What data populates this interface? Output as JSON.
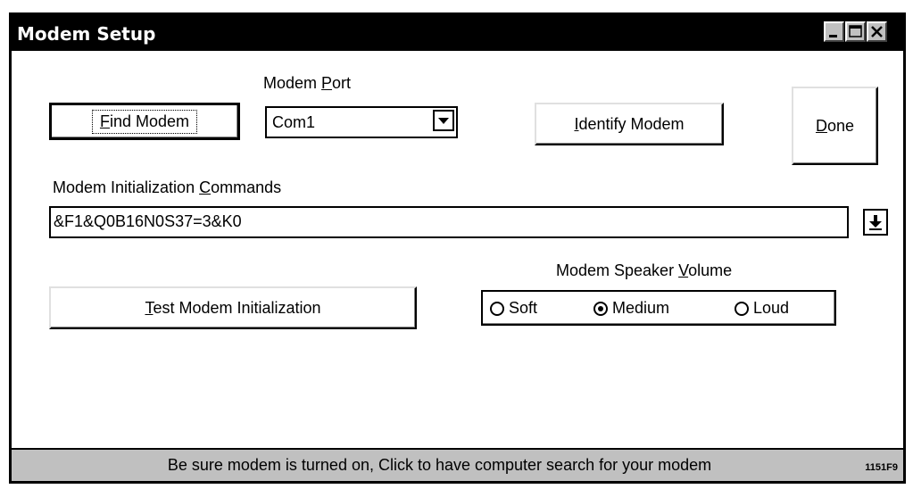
{
  "window": {
    "title": "Modem Setup"
  },
  "modem_port": {
    "label_pre": "Modem ",
    "label_key": "P",
    "label_post": "ort",
    "selected": "Com1"
  },
  "buttons": {
    "find_modem": {
      "key": "F",
      "rest": "ind Modem"
    },
    "identify_modem": {
      "key": "I",
      "rest": "dentify Modem"
    },
    "done": {
      "key": "D",
      "rest": "one"
    },
    "test_init": {
      "key": "T",
      "rest": "est Modem Initialization"
    }
  },
  "init_commands": {
    "label_pre": "Modem Initialization ",
    "label_key": "C",
    "label_post": "ommands",
    "value": "&F1&Q0B16N0S37=3&K0"
  },
  "speaker_volume": {
    "label_pre": "Modem Speaker ",
    "label_key": "V",
    "label_post": "olume",
    "options": [
      "Soft",
      "Medium",
      "Loud"
    ],
    "selected": "Medium"
  },
  "status": {
    "text": "Be sure modem is turned on, Click to have computer search for your modem"
  },
  "figure_id": "1151F9"
}
